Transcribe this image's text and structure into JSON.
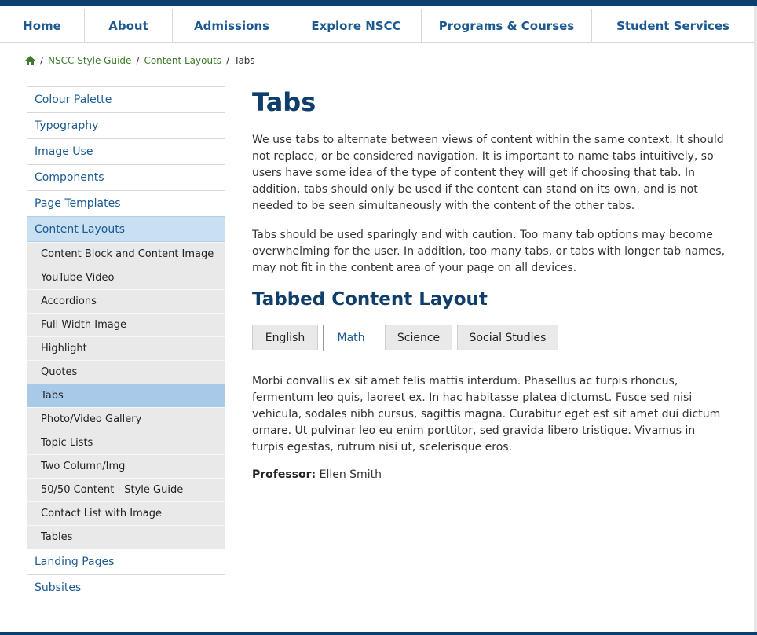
{
  "nav": [
    {
      "label": "Home"
    },
    {
      "label": "About"
    },
    {
      "label": "Admissions"
    },
    {
      "label": "Explore NSCC"
    },
    {
      "label": "Programs & Courses"
    },
    {
      "label": "Student Services"
    }
  ],
  "breadcrumb": {
    "items": [
      "NSCC Style Guide",
      "Content Layouts"
    ],
    "current": "Tabs",
    "separator": "/"
  },
  "sidebar": {
    "top_items_before": [
      "Colour Palette",
      "Typography",
      "Image Use",
      "Components",
      "Page Templates"
    ],
    "active_section": "Content Layouts",
    "sub_items": [
      "Content Block and Content Image",
      "YouTube Video",
      "Accordions",
      "Full Width Image",
      "Highlight",
      "Quotes",
      "Tabs",
      "Photo/Video Gallery",
      "Topic Lists",
      "Two Column/Img",
      "50/50 Content - Style Guide",
      "Contact List with Image",
      "Tables"
    ],
    "active_sub": "Tabs",
    "top_items_after": [
      "Landing Pages",
      "Subsites"
    ]
  },
  "content": {
    "title": "Tabs",
    "para1": "We use tabs to alternate between views of content within the same context. It should not replace, or be considered navigation. It is important to name tabs intuitively, so users have some idea of the type of content they will get if choosing that tab. In addition, tabs should only be used if the content can stand on its own, and is not needed to be seen simultaneously with the content of the other tabs.",
    "para2": "Tabs should be used sparingly and with caution. Too many tab options may become overwhelming for the user. In addition, too many tabs, or tabs with longer tab names, may not fit in the content area of your page on all devices.",
    "subheading": "Tabbed Content Layout",
    "tabs": [
      "English",
      "Math",
      "Science",
      "Social Studies"
    ],
    "active_tab": "Math",
    "tab_text": "Morbi convallis ex sit amet felis mattis interdum. Phasellus ac turpis rhoncus, fermentum leo quis, laoreet ex. In hac habitasse platea dictumst. Fusce sed nisi vehicula, sodales nibh cursus, sagittis magna. Curabitur eget est sit amet dui dictum ornare. Ut pulvinar leo eu enim porttitor, sed gravida libero tristique. Vivamus in turpis egestas, rutrum nisi ut, scelerisque eros.",
    "professor_label": "Professor:",
    "professor_name": "Ellen Smith"
  },
  "colors": {
    "brand_navy": "#0b3f6e",
    "link_blue": "#1c5a91",
    "breadcrumb_green": "#3d7a2c",
    "active_section_bg": "#c9dff2",
    "active_sub_bg": "#a9c9e8"
  },
  "icons": {
    "breadcrumb_home": "home-icon"
  }
}
